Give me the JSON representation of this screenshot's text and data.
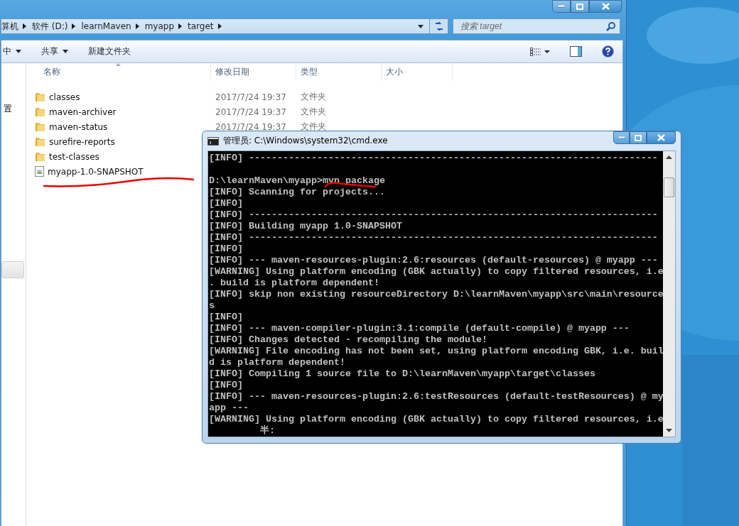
{
  "explorer": {
    "breadcrumb": [
      "算机",
      "软件 (D:)",
      "learnMaven",
      "myapp",
      "target"
    ],
    "search": {
      "placeholder": "搜索 target"
    },
    "toolbar": [
      {
        "label": "中",
        "dropdown": true
      },
      {
        "label": "共享",
        "dropdown": true
      },
      {
        "label": "新建文件夹",
        "dropdown": false
      }
    ],
    "nav_pane": [
      "置"
    ],
    "columns": [
      "名称",
      "修改日期",
      "类型",
      "大小"
    ],
    "files": [
      {
        "name": "classes",
        "date": "2017/7/24 19:37",
        "type": "文件夹",
        "kind": "folder"
      },
      {
        "name": "maven-archiver",
        "date": "2017/7/24 19:37",
        "type": "文件夹",
        "kind": "folder"
      },
      {
        "name": "maven-status",
        "date": "2017/7/24 19:37",
        "type": "文件夹",
        "kind": "folder"
      },
      {
        "name": "surefire-reports",
        "kind": "folder"
      },
      {
        "name": "test-classes",
        "kind": "folder"
      },
      {
        "name": "myapp-1.0-SNAPSHOT",
        "kind": "file",
        "underlined": true
      }
    ]
  },
  "cmd": {
    "title": "管理员: C:\\Windows\\system32\\cmd.exe",
    "lines": [
      {
        "text": "[INFO] ------------------------------------------------------------------------"
      },
      {
        "text": "D:\\learnMaven\\myapp>mvn package",
        "blank_before": true
      },
      {
        "text": "[INFO] Scanning for projects..."
      },
      {
        "text": "[INFO]"
      },
      {
        "text": "[INFO] ------------------------------------------------------------------------"
      },
      {
        "text": "[INFO] Building myapp 1.0-SNAPSHOT"
      },
      {
        "text": "[INFO] ------------------------------------------------------------------------"
      },
      {
        "text": "[INFO]"
      },
      {
        "text": "[INFO] --- maven-resources-plugin:2.6:resources (default-resources) @ myapp ---"
      },
      {
        "text": "[WARNING] Using platform encoding (GBK actually) to copy filtered resources, i.e"
      },
      {
        "text": ". build is platform dependent!"
      },
      {
        "text": "[INFO] skip non existing resourceDirectory D:\\learnMaven\\myapp\\src\\main\\resource"
      },
      {
        "text": "s"
      },
      {
        "text": "[INFO]"
      },
      {
        "text": "[INFO] --- maven-compiler-plugin:3.1:compile (default-compile) @ myapp ---"
      },
      {
        "text": "[INFO] Changes detected - recompiling the module!"
      },
      {
        "text": "[WARNING] File encoding has not been set, using platform encoding GBK, i.e. buil"
      },
      {
        "text": "d is platform dependent!"
      },
      {
        "text": "[INFO] Compiling 1 source file to D:\\learnMaven\\myapp\\target\\classes"
      },
      {
        "text": "[INFO]"
      },
      {
        "text": "[INFO] --- maven-resources-plugin:2.6:testResources (default-testResources) @ my"
      },
      {
        "text": "app ---"
      },
      {
        "text": "[WARNING] Using platform encoding (GBK actually) to copy filtered resources, i.e"
      },
      {
        "text": "         半:"
      }
    ],
    "command_underlined": true
  }
}
